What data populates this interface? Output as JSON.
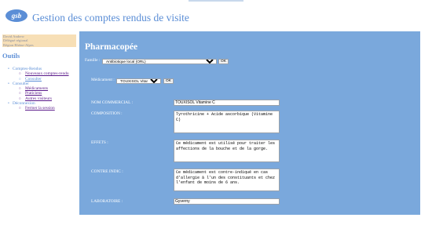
{
  "header": {
    "title": "Gestion des comptes rendus de visite",
    "logo_text": "gsb"
  },
  "user": {
    "name": "David Andrew",
    "role": "Délégué régional",
    "region": "Région Rhône-Alpes"
  },
  "sidebar": {
    "title": "Outils",
    "sections": [
      {
        "label": "Comptes-Rendus",
        "items": [
          {
            "label": "Nouveaux comptes-rendu",
            "link": true
          },
          {
            "label": "Consulter",
            "link": false
          }
        ]
      },
      {
        "label": "Consulter",
        "items": [
          {
            "label": "Médicaments",
            "link": true
          },
          {
            "label": "Praticiens",
            "link": true
          },
          {
            "label": "Autres visiteurs",
            "link": true
          }
        ]
      },
      {
        "label": "Déconnexion",
        "items": [
          {
            "label": "Fermer la session",
            "link": true
          }
        ]
      }
    ]
  },
  "main": {
    "title": "Pharmacopée",
    "famille": {
      "label": "Famille :",
      "selected": "Antibiotique local (ORL)",
      "ok": "OK"
    },
    "medicament": {
      "label": "Médicament :",
      "selected": "TOUXISOL Vitamine C",
      "ok": "OK"
    },
    "fields": {
      "nom_commercial": {
        "label": "NOM COMMERCIAL :",
        "value": "TOUXISOL Vitamine C"
      },
      "composition": {
        "label": "COMPOSITION :",
        "value": "Tyrothricine + Acide ascorbique (Vitamine C)"
      },
      "effets": {
        "label": "EFFETS :",
        "value": "Ce médicament est utilisé pour traiter les affections de la bouche et de la gorge."
      },
      "contre_indic": {
        "label": "CONTRE INDIC :",
        "value": "Ce médicament est contre-indiqué en cas d'allergie à l'un des constituants et chez l'enfant de moins de 6 ans."
      },
      "laboratoire": {
        "label": "LABORATOIRE :",
        "value": "Gyverny"
      }
    }
  }
}
